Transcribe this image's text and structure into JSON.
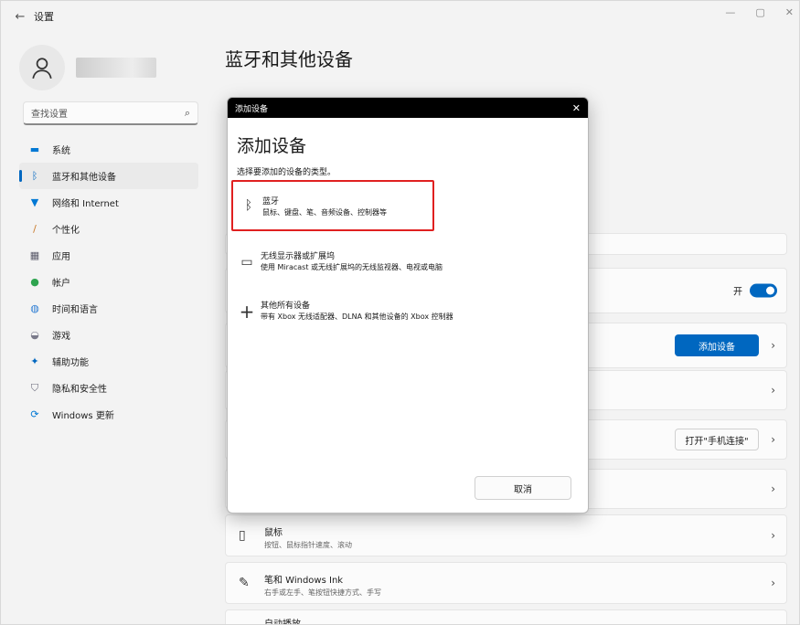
{
  "window": {
    "title": "设置",
    "back_icon": "←",
    "minimize": "—",
    "maximize": "▢",
    "close": "✕"
  },
  "sidebar": {
    "search_placeholder": "查找设置",
    "items": [
      {
        "label": "系统",
        "icon": "system-icon",
        "color": "#0078d4",
        "active": false
      },
      {
        "label": "蓝牙和其他设备",
        "icon": "bluetooth-icon",
        "color": "#0067c0",
        "active": true
      },
      {
        "label": "网络和 Internet",
        "icon": "network-icon",
        "color": "#0078d4",
        "active": false
      },
      {
        "label": "个性化",
        "icon": "brush-icon",
        "color": "#c97a2a",
        "active": false
      },
      {
        "label": "应用",
        "icon": "apps-icon",
        "color": "#5a5a6a",
        "active": false
      },
      {
        "label": "帐户",
        "icon": "account-icon",
        "color": "#2ea44f",
        "active": false
      },
      {
        "label": "时间和语言",
        "icon": "globe-icon",
        "color": "#2b7cd3",
        "active": false
      },
      {
        "label": "游戏",
        "icon": "gamepad-icon",
        "color": "#7a7a8a",
        "active": false
      },
      {
        "label": "辅助功能",
        "icon": "accessibility-icon",
        "color": "#0067c0",
        "active": false
      },
      {
        "label": "隐私和安全性",
        "icon": "shield-icon",
        "color": "#6a6a7a",
        "active": false
      },
      {
        "label": "Windows 更新",
        "icon": "update-icon",
        "color": "#0078d4",
        "active": false
      }
    ]
  },
  "main": {
    "page_title": "蓝牙和其他设备",
    "bluetooth_toggle_label": "开",
    "add_device_button": "添加设备",
    "phone_link_button": "打开\"手机连接\"",
    "mouse_title": "鼠标",
    "mouse_sub": "按钮、鼠标指针速度、滚动",
    "pen_title": "笔和 Windows Ink",
    "pen_sub": "右手或左手、笔按钮快捷方式、手写",
    "autoplay_title": "自动播放"
  },
  "dialog": {
    "bar_title": "添加设备",
    "title": "添加设备",
    "subtitle": "选择要添加的设备的类型。",
    "options": [
      {
        "icon": "bluetooth-icon",
        "title": "蓝牙",
        "sub": "鼠标、键盘、笔、音频设备、控制器等",
        "highlighted": true
      },
      {
        "icon": "monitor-icon",
        "title": "无线显示器或扩展坞",
        "sub": "使用 Miracast 或无线扩展坞的无线监视器、电视或电脑",
        "highlighted": false
      },
      {
        "icon": "plus-icon",
        "title": "其他所有设备",
        "sub": "带有 Xbox 无线适配器、DLNA 和其他设备的 Xbox 控制器",
        "highlighted": false
      }
    ],
    "cancel": "取消"
  }
}
